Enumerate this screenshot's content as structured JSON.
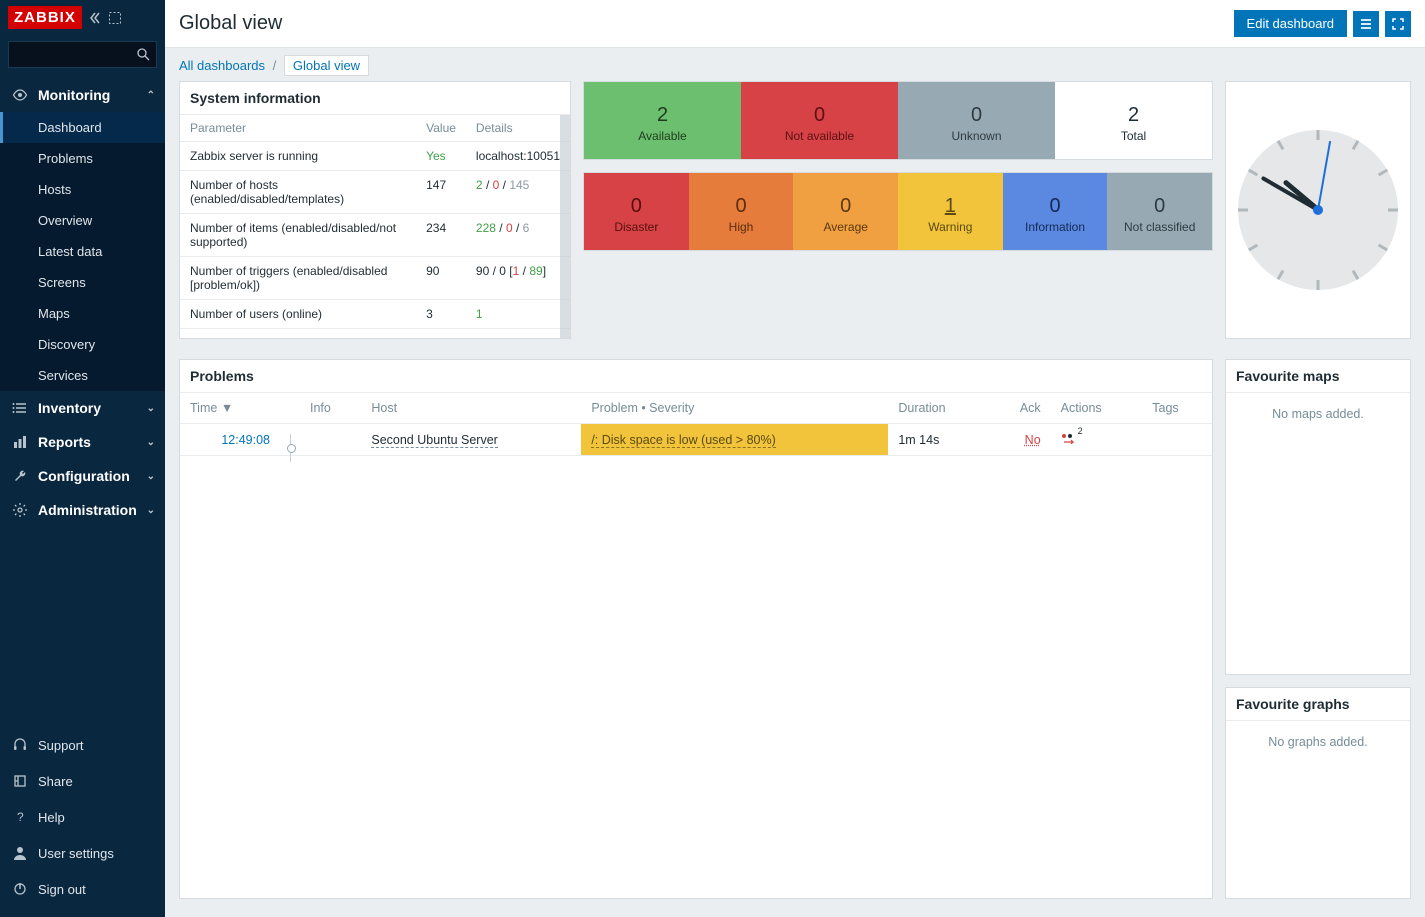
{
  "brand": "ZABBIX",
  "sidebar": {
    "search_placeholder": "",
    "sections": [
      {
        "id": "monitoring",
        "label": "Monitoring",
        "icon": "eye-icon",
        "expanded": true,
        "items": [
          {
            "id": "dashboard",
            "label": "Dashboard",
            "active": true
          },
          {
            "id": "problems",
            "label": "Problems"
          },
          {
            "id": "hosts",
            "label": "Hosts"
          },
          {
            "id": "overview",
            "label": "Overview"
          },
          {
            "id": "latest",
            "label": "Latest data"
          },
          {
            "id": "screens",
            "label": "Screens"
          },
          {
            "id": "maps",
            "label": "Maps"
          },
          {
            "id": "discovery",
            "label": "Discovery"
          },
          {
            "id": "services",
            "label": "Services"
          }
        ]
      },
      {
        "id": "inventory",
        "label": "Inventory",
        "icon": "list-icon",
        "expanded": false
      },
      {
        "id": "reports",
        "label": "Reports",
        "icon": "chart-icon",
        "expanded": false
      },
      {
        "id": "configuration",
        "label": "Configuration",
        "icon": "wrench-icon",
        "expanded": false
      },
      {
        "id": "administration",
        "label": "Administration",
        "icon": "gear-icon",
        "expanded": false
      }
    ],
    "bottom": [
      {
        "id": "support",
        "label": "Support",
        "icon": "headset-icon"
      },
      {
        "id": "share",
        "label": "Share",
        "icon": "share-icon"
      },
      {
        "id": "help",
        "label": "Help",
        "icon": "question-icon"
      },
      {
        "id": "user",
        "label": "User settings",
        "icon": "user-icon"
      },
      {
        "id": "signout",
        "label": "Sign out",
        "icon": "power-icon"
      }
    ]
  },
  "page": {
    "title": "Global view",
    "edit_button": "Edit dashboard",
    "breadcrumb": {
      "all": "All dashboards",
      "current": "Global view"
    }
  },
  "widgets": {
    "sysinfo": {
      "title": "System information",
      "headers": {
        "param": "Parameter",
        "value": "Value",
        "details": "Details"
      },
      "rows": [
        {
          "param": "Zabbix server is running",
          "value": "Yes",
          "value_class": "green",
          "details_plain": "localhost:10051"
        },
        {
          "param": "Number of hosts (enabled/disabled/templates)",
          "value": "147",
          "details_parts": [
            {
              "t": "2",
              "c": "green"
            },
            {
              "t": " / "
            },
            {
              "t": "0",
              "c": "red"
            },
            {
              "t": " / "
            },
            {
              "t": "145",
              "c": "grey"
            }
          ]
        },
        {
          "param": "Number of items (enabled/disabled/not supported)",
          "value": "234",
          "details_parts": [
            {
              "t": "228",
              "c": "green"
            },
            {
              "t": " / "
            },
            {
              "t": "0",
              "c": "red"
            },
            {
              "t": " / "
            },
            {
              "t": "6",
              "c": "grey"
            }
          ]
        },
        {
          "param": "Number of triggers (enabled/disabled [problem/ok])",
          "value": "90",
          "details_parts": [
            {
              "t": "90 / 0 ["
            },
            {
              "t": "1",
              "c": "red"
            },
            {
              "t": " / "
            },
            {
              "t": "89",
              "c": "green"
            },
            {
              "t": "]"
            }
          ]
        },
        {
          "param": "Number of users (online)",
          "value": "3",
          "details_parts": [
            {
              "t": "1",
              "c": "green"
            }
          ]
        }
      ]
    },
    "host_avail": [
      {
        "value": "2",
        "label": "Available",
        "cls": "green"
      },
      {
        "value": "0",
        "label": "Not available",
        "cls": "red"
      },
      {
        "value": "0",
        "label": "Unknown",
        "cls": "grey"
      },
      {
        "value": "2",
        "label": "Total",
        "cls": "white"
      }
    ],
    "severity": [
      {
        "value": "0",
        "label": "Disaster",
        "cls": "disaster"
      },
      {
        "value": "0",
        "label": "High",
        "cls": "high"
      },
      {
        "value": "0",
        "label": "Average",
        "cls": "average"
      },
      {
        "value": "1",
        "label": "Warning",
        "cls": "warning",
        "underline": true
      },
      {
        "value": "0",
        "label": "Information",
        "cls": "info"
      },
      {
        "value": "0",
        "label": "Not classified",
        "cls": "na"
      }
    ],
    "problems": {
      "title": "Problems",
      "headers": {
        "time": "Time",
        "info": "Info",
        "host": "Host",
        "problem": "Problem • Severity",
        "duration": "Duration",
        "ack": "Ack",
        "actions": "Actions",
        "tags": "Tags"
      },
      "rows": [
        {
          "time": "12:49:08",
          "host": "Second Ubuntu Server",
          "problem": "/: Disk space is low (used > 80%)",
          "severity": "warning",
          "duration": "1m 14s",
          "ack": "No",
          "actions_count": "2"
        }
      ]
    },
    "fav_maps": {
      "title": "Favourite maps",
      "empty": "No maps added."
    },
    "fav_graphs": {
      "title": "Favourite graphs",
      "empty": "No graphs added."
    }
  },
  "clock": {
    "hour_deg": 310,
    "min_deg": 300,
    "sec_deg": 10
  }
}
